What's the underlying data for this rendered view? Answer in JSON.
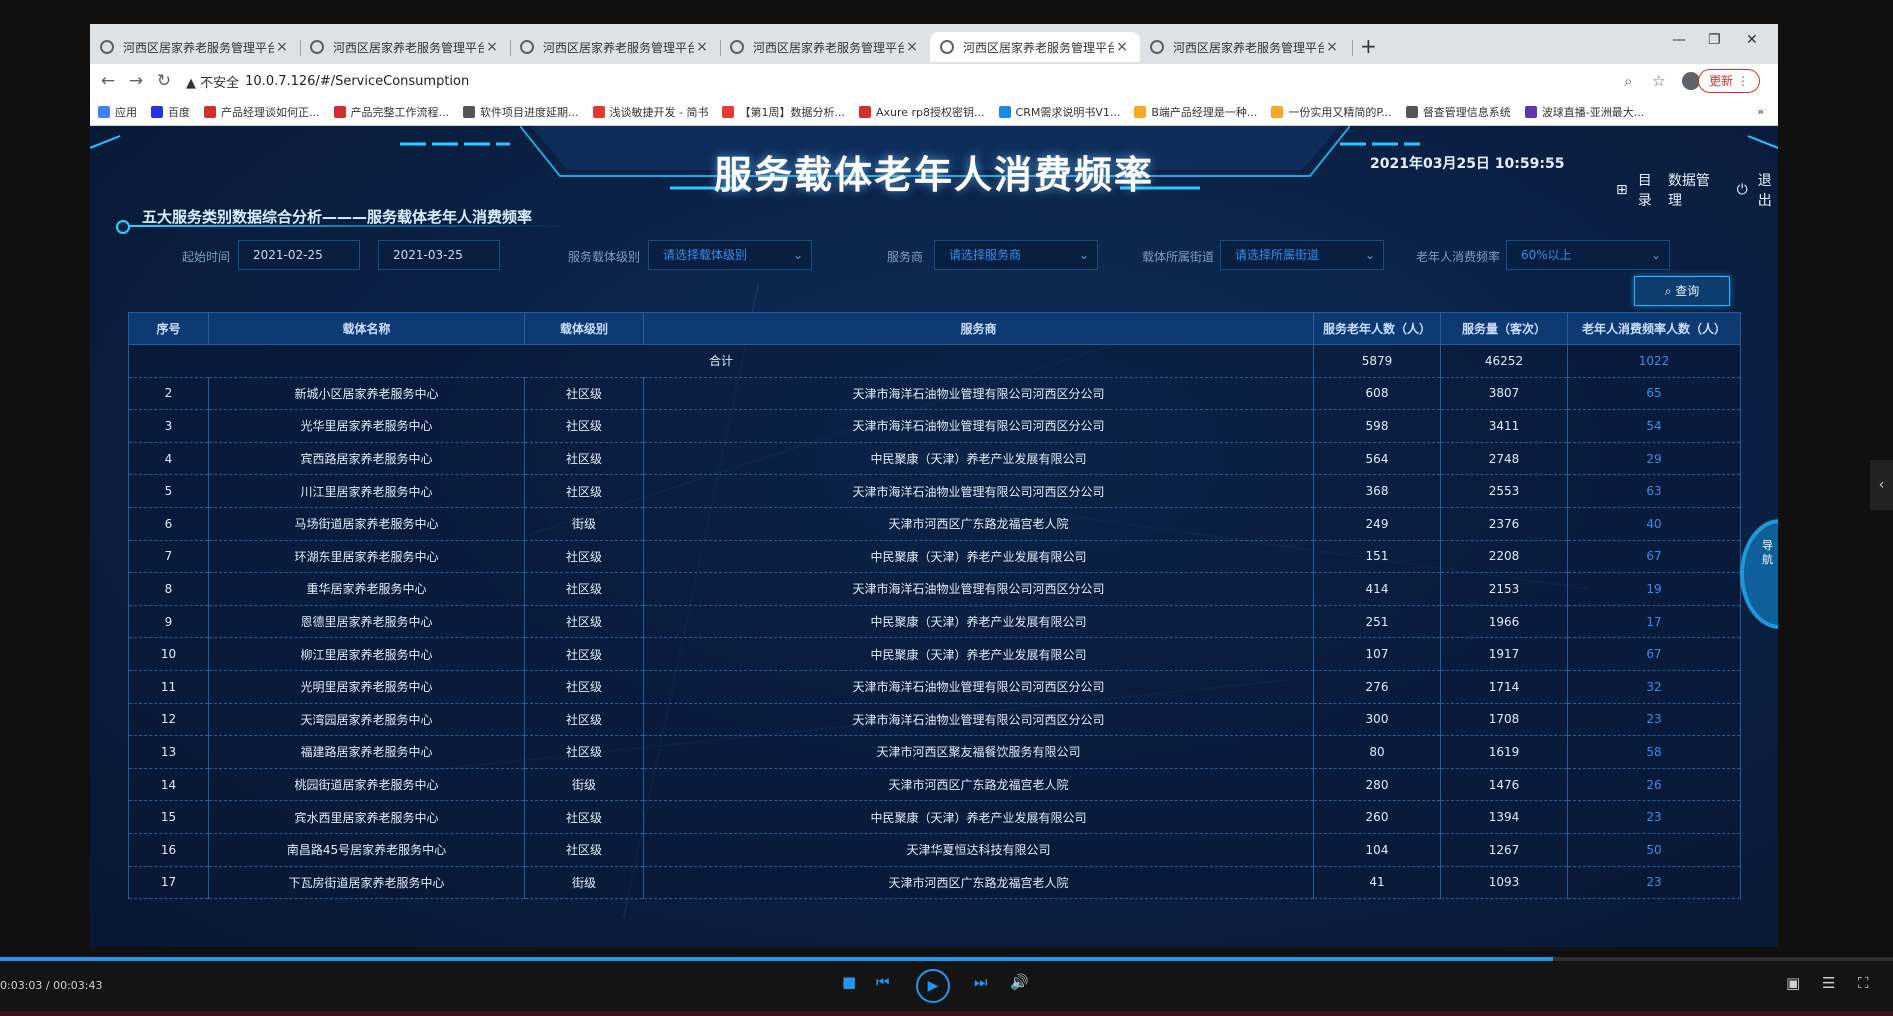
{
  "browser": {
    "tabs": [
      {
        "title": "河西区居家养老服务管理平台",
        "active": false
      },
      {
        "title": "河西区居家养老服务管理平台",
        "active": false
      },
      {
        "title": "河西区居家养老服务管理平台",
        "active": false
      },
      {
        "title": "河西区居家养老服务管理平台",
        "active": false
      },
      {
        "title": "河西区居家养老服务管理平台",
        "active": true
      },
      {
        "title": "河西区居家养老服务管理平台",
        "active": false
      }
    ],
    "tab_close": "×",
    "new_tab": "+",
    "url_warning": "▲ 不安全",
    "url": "10.0.7.126/#/ServiceConsumption",
    "update_label": "更新",
    "bookmarks": [
      {
        "label": "应用",
        "color": "#4285f4"
      },
      {
        "label": "百度",
        "color": "#2932e1"
      },
      {
        "label": "产品经理谈如何正...",
        "color": "#d32f2f"
      },
      {
        "label": "产品完整工作流程...",
        "color": "#d32f2f"
      },
      {
        "label": "软件项目进度延期...",
        "color": "#555555"
      },
      {
        "label": "浅谈敏捷开发 - 简书",
        "color": "#e53935"
      },
      {
        "label": "【第1周】数据分析...",
        "color": "#e53935"
      },
      {
        "label": "Axure rp8授权密钥...",
        "color": "#d32f2f"
      },
      {
        "label": "CRM需求说明书V1...",
        "color": "#1e88e5"
      },
      {
        "label": "B端产品经理是一种...",
        "color": "#f9a825"
      },
      {
        "label": "一份实用又精简的P...",
        "color": "#f9a825"
      },
      {
        "label": "督查管理信息系统",
        "color": "#555555"
      },
      {
        "label": "波球直播-亚洲最大...",
        "color": "#5e35b1"
      }
    ],
    "more_bookmarks": "»"
  },
  "dashboard": {
    "title": "服务载体老年人消费频率",
    "datetime": "2021年03月25日 10:59:55",
    "nav": {
      "catalog": "目录",
      "data_mgmt": "数据管理",
      "logout": "退出"
    },
    "section_title": "五大服务类别数据综合分析———服务载体老年人消费频率",
    "filters": {
      "start_label": "起始时间",
      "start_date": "2021-02-25",
      "end_date": "2021-03-25",
      "level_label": "服务载体级别",
      "level_placeholder": "请选择载体级别",
      "provider_label": "服务商",
      "provider_placeholder": "请选择服务商",
      "street_label": "载体所属街道",
      "street_placeholder": "请选择所属街道",
      "freq_label": "老年人消费频率",
      "freq_value": "60%以上"
    },
    "query_label": "查询",
    "side_nav_label": "导航"
  },
  "table": {
    "headers": [
      "序号",
      "载体名称",
      "载体级别",
      "服务商",
      "服务老年人数（人）",
      "服务量（客次）",
      "老年人消费频率人数（人）"
    ],
    "total": {
      "label": "合计",
      "elders": "5879",
      "service": "46252",
      "freq": "1022"
    },
    "rows": [
      [
        "2",
        "新城小区居家养老服务中心",
        "社区级",
        "天津市海洋石油物业管理有限公司河西区分公司",
        "608",
        "3807",
        "65"
      ],
      [
        "3",
        "光华里居家养老服务中心",
        "社区级",
        "天津市海洋石油物业管理有限公司河西区分公司",
        "598",
        "3411",
        "54"
      ],
      [
        "4",
        "宾西路居家养老服务中心",
        "社区级",
        "中民聚康（天津）养老产业发展有限公司",
        "564",
        "2748",
        "29"
      ],
      [
        "5",
        "川江里居家养老服务中心",
        "社区级",
        "天津市海洋石油物业管理有限公司河西区分公司",
        "368",
        "2553",
        "63"
      ],
      [
        "6",
        "马场街道居家养老服务中心",
        "街级",
        "天津市河西区广东路龙福宫老人院",
        "249",
        "2376",
        "40"
      ],
      [
        "7",
        "环湖东里居家养老服务中心",
        "社区级",
        "中民聚康（天津）养老产业发展有限公司",
        "151",
        "2208",
        "67"
      ],
      [
        "8",
        "重华居家养老服务中心",
        "社区级",
        "天津市海洋石油物业管理有限公司河西区分公司",
        "414",
        "2153",
        "19"
      ],
      [
        "9",
        "恩德里居家养老服务中心",
        "社区级",
        "中民聚康（天津）养老产业发展有限公司",
        "251",
        "1966",
        "17"
      ],
      [
        "10",
        "柳江里居家养老服务中心",
        "社区级",
        "中民聚康（天津）养老产业发展有限公司",
        "107",
        "1917",
        "67"
      ],
      [
        "11",
        "光明里居家养老服务中心",
        "社区级",
        "天津市海洋石油物业管理有限公司河西区分公司",
        "276",
        "1714",
        "32"
      ],
      [
        "12",
        "天湾园居家养老服务中心",
        "社区级",
        "天津市海洋石油物业管理有限公司河西区分公司",
        "300",
        "1708",
        "23"
      ],
      [
        "13",
        "福建路居家养老服务中心",
        "社区级",
        "天津市河西区聚友福餐饮服务有限公司",
        "80",
        "1619",
        "58"
      ],
      [
        "14",
        "桃园街道居家养老服务中心",
        "街级",
        "天津市河西区广东路龙福宫老人院",
        "280",
        "1476",
        "26"
      ],
      [
        "15",
        "宾水西里居家养老服务中心",
        "社区级",
        "中民聚康（天津）养老产业发展有限公司",
        "260",
        "1394",
        "23"
      ],
      [
        "16",
        "南昌路45号居家养老服务中心",
        "社区级",
        "天津华夏恒达科技有限公司",
        "104",
        "1267",
        "50"
      ],
      [
        "17",
        "下瓦房街道居家养老服务中心",
        "街级",
        "天津市河西区广东路龙福宫老人院",
        "41",
        "1093",
        "23"
      ]
    ]
  },
  "player": {
    "time": "0:03:03 / 00:03:43",
    "progress_fraction": 0.8206
  }
}
